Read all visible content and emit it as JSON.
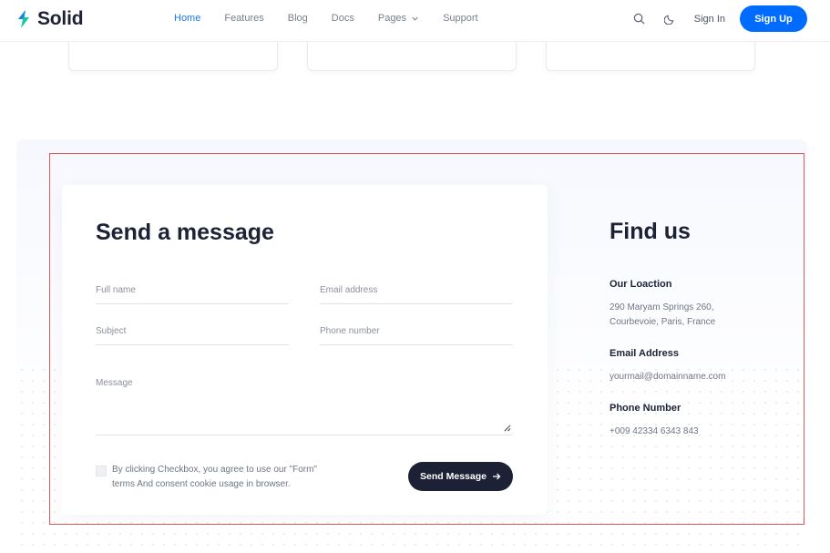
{
  "header": {
    "logo_text": "Solid",
    "nav": [
      {
        "label": "Home",
        "active": true
      },
      {
        "label": "Features",
        "active": false
      },
      {
        "label": "Blog",
        "active": false
      },
      {
        "label": "Docs",
        "active": false
      },
      {
        "label": "Pages",
        "active": false,
        "has_dropdown": true
      },
      {
        "label": "Support",
        "active": false
      }
    ],
    "signin_label": "Sign In",
    "signup_label": "Sign Up"
  },
  "form": {
    "title": "Send a message",
    "full_name_label": "Full name",
    "email_label": "Email address",
    "subject_label": "Subject",
    "phone_label": "Phone number",
    "message_label": "Message",
    "consent_text": "By clicking Checkbox, you agree to use our \"Form\" terms And consent cookie usage in browser.",
    "send_label": "Send Message"
  },
  "find_us": {
    "title": "Find us",
    "location_label": "Our Loaction",
    "location_value": "290 Maryam Springs 260, Courbevoie, Paris, France",
    "email_label": "Email Address",
    "email_value": "yourmail@domainname.com",
    "phone_label": "Phone Number",
    "phone_value": "+009 42334 6343 843"
  },
  "colors": {
    "accent": "#006bff",
    "nav_active": "#1877f2",
    "dark": "#1c2136",
    "highlight_border": "#e05a5a"
  }
}
